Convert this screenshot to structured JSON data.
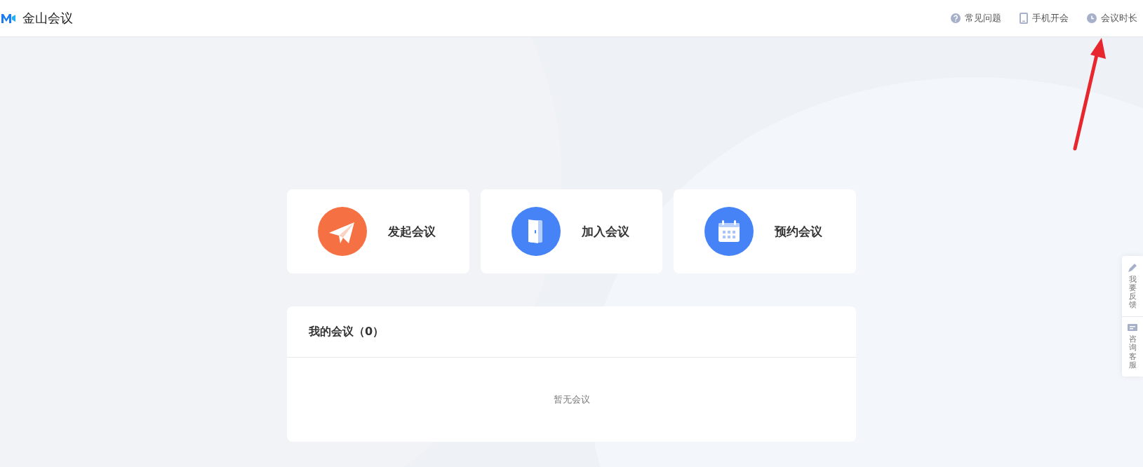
{
  "header": {
    "title": "金山会议",
    "links": [
      {
        "kind": "help",
        "label": "常见问题"
      },
      {
        "kind": "phone",
        "label": "手机开会"
      },
      {
        "kind": "clock",
        "label": "会议时长"
      }
    ]
  },
  "actions": [
    {
      "kind": "start",
      "label": "发起会议",
      "color": "#f57042"
    },
    {
      "kind": "join",
      "label": "加入会议",
      "color": "#4583f7"
    },
    {
      "kind": "schedule",
      "label": "预约会议",
      "color": "#4583f7"
    }
  ],
  "meetings": {
    "title": "我的会议（0）",
    "empty_text": "暂无会议"
  },
  "side_panel": [
    {
      "kind": "feedback",
      "label": "我要反馈"
    },
    {
      "kind": "service",
      "label": "咨询客服"
    }
  ]
}
